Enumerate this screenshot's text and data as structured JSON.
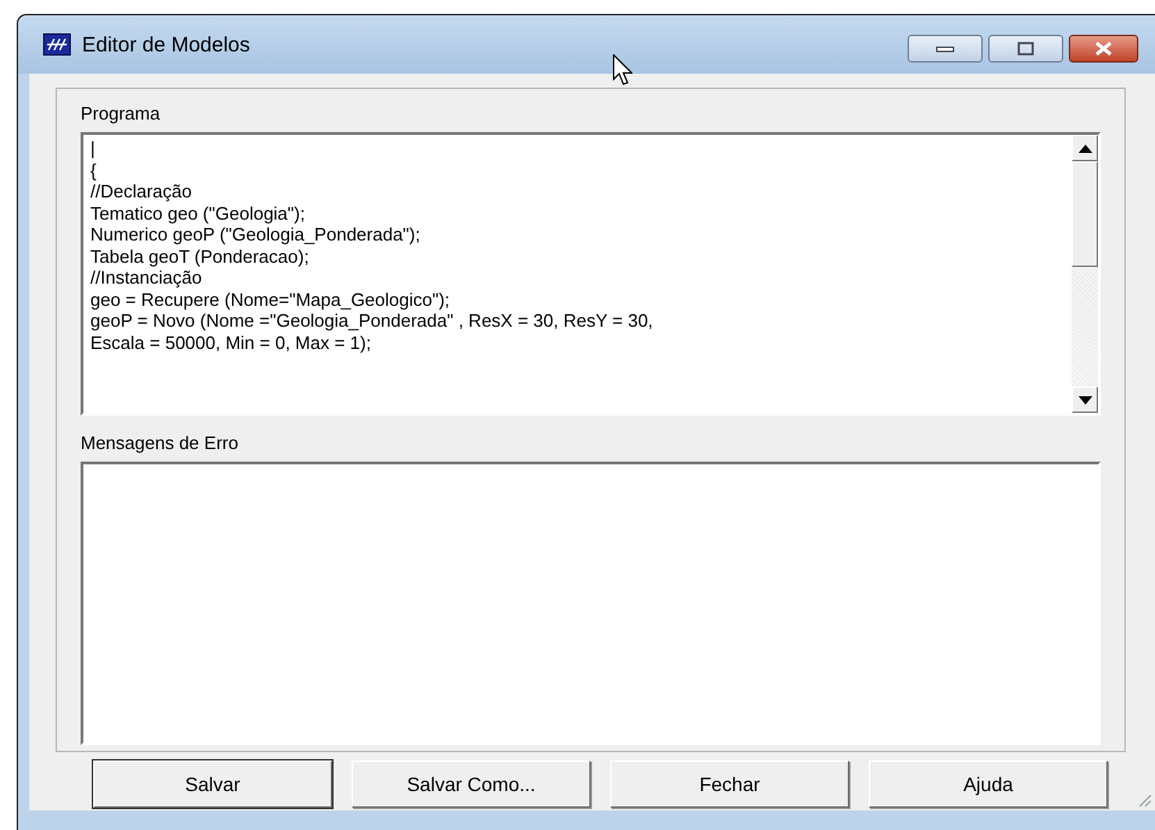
{
  "window": {
    "title": "Editor de Modelos"
  },
  "program": {
    "label": "Programa",
    "lines": [
      "|",
      "{",
      "//Declaração",
      "Tematico geo (\"Geologia\");",
      "Numerico geoP (\"Geologia_Ponderada\");",
      "Tabela geoT (Ponderacao);",
      "//Instanciação",
      "geo = Recupere (Nome=\"Mapa_Geologico\");",
      "geoP = Novo (Nome =\"Geologia_Ponderada\" , ResX = 30, ResY = 30,",
      "Escala = 50000, Min = 0, Max = 1);"
    ]
  },
  "errors": {
    "label": "Mensagens de Erro"
  },
  "buttons": [
    "Salvar",
    "Salvar Como...",
    "Fechar",
    "Ajuda"
  ]
}
